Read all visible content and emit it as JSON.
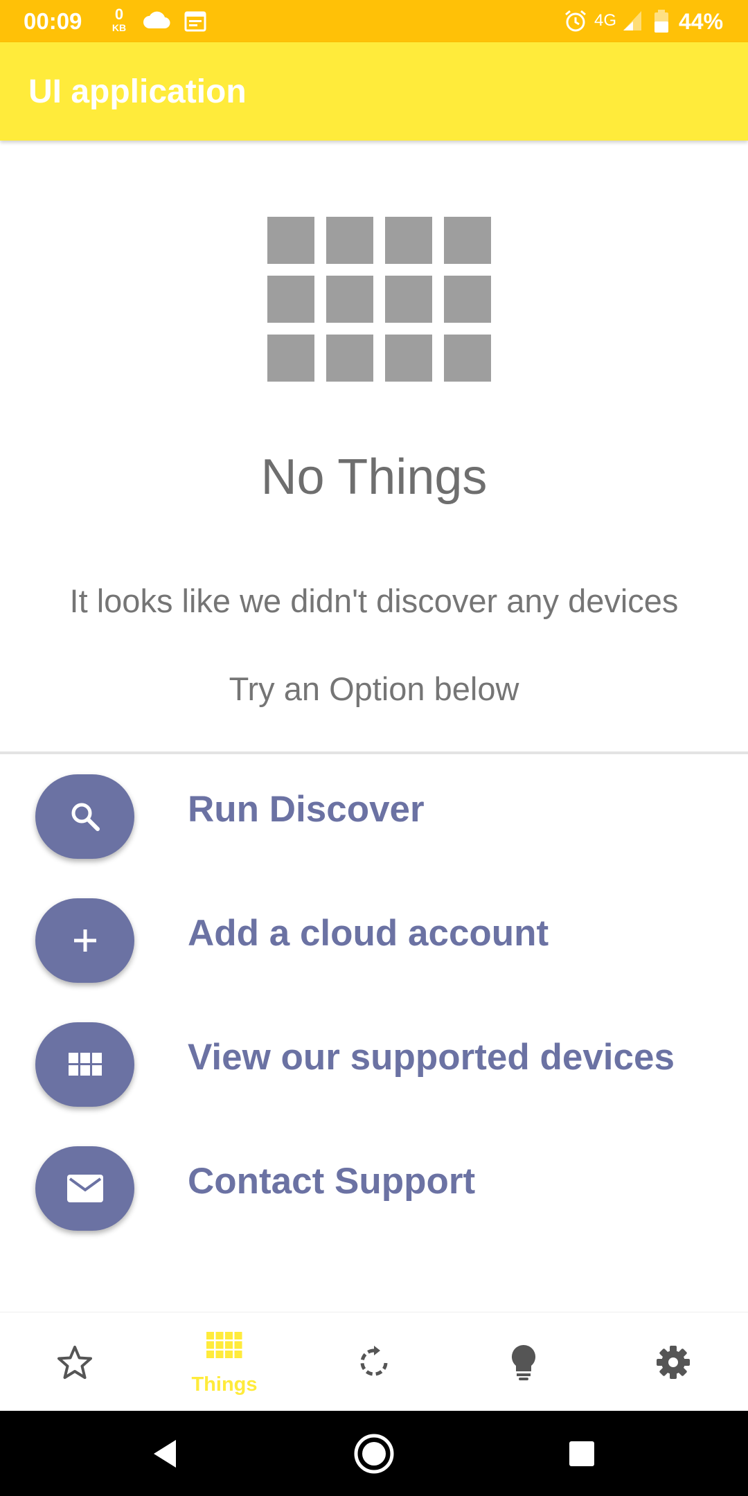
{
  "status_bar": {
    "time": "00:09",
    "data_rate_value": "0",
    "data_rate_unit": "KB",
    "network": "4G",
    "battery": "44%"
  },
  "app_bar": {
    "title": "UI application"
  },
  "empty_state": {
    "icon": "grid-icon",
    "title": "No Things",
    "description": "It looks like we didn't discover any devices",
    "hint": "Try an Option below"
  },
  "options": [
    {
      "icon": "search-icon",
      "label": "Run Discover"
    },
    {
      "icon": "plus-icon",
      "label": "Add a cloud account"
    },
    {
      "icon": "apps-icon",
      "label": "View our supported devices"
    },
    {
      "icon": "mail-icon",
      "label": "Contact Support"
    }
  ],
  "bottom_nav": {
    "items": [
      {
        "icon": "star-icon",
        "label": "",
        "active": false
      },
      {
        "icon": "grid-icon",
        "label": "Things",
        "active": true
      },
      {
        "icon": "refresh-icon",
        "label": "",
        "active": false
      },
      {
        "icon": "lightbulb-icon",
        "label": "",
        "active": false
      },
      {
        "icon": "gear-icon",
        "label": "",
        "active": false
      }
    ]
  },
  "colors": {
    "status_bar": "#ffc107",
    "app_bar": "#ffeb3b",
    "accent": "#6b72a3",
    "empty_icon": "#9e9e9e",
    "nav_active": "#ffeb3b",
    "nav_inactive": "#555555"
  }
}
